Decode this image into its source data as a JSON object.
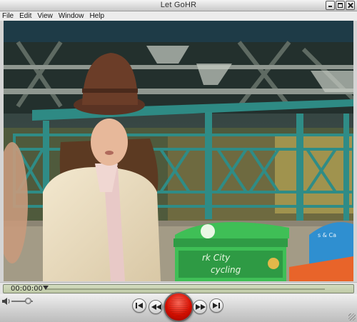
{
  "window": {
    "title": "Let GoHR"
  },
  "menu": [
    "File",
    "Edit",
    "View",
    "Window",
    "Help"
  ],
  "video": {
    "scene": "woman-in-hat-park-scene",
    "sign_text": "rk City\ncycling",
    "bin_text": "s & Ca",
    "colors": {
      "bridge": "#2a2f2b",
      "railing": "#2f8c86",
      "green_bin": "#3fbf56",
      "blue_bin": "#2f8fd0",
      "orange_bin": "#e8642a"
    }
  },
  "timeline": {
    "current_time": "00:00:00",
    "progress": 0.0
  },
  "controls": {
    "volume_level": 0.75,
    "buttons": [
      "skip-to-start",
      "rewind",
      "play",
      "fast-forward",
      "skip-to-end"
    ]
  }
}
